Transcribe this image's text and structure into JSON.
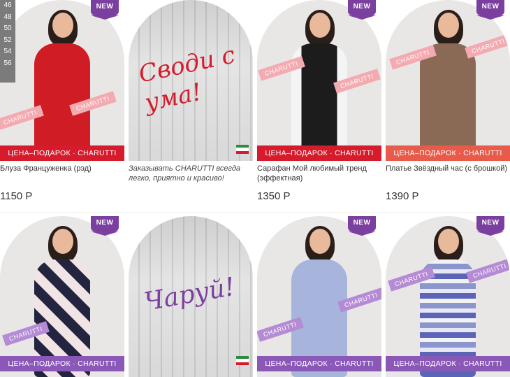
{
  "badge": "NEW",
  "strip_label": "ЦЕНА–ПОДАРОК · CHARUTTI",
  "brand_tag": "CHARUTTI",
  "sizes": [
    "46",
    "48",
    "50",
    "52",
    "54",
    "56"
  ],
  "row1": [
    {
      "name": "Блуза Француженка (рэд)",
      "price": "1150 Р"
    },
    {
      "script": "Своди с ума!",
      "caption": "Заказывать CHARUTTI всегда легко, приятно и красиво!"
    },
    {
      "name": "Сарафан Мой любимый тренд (эффектная)",
      "price": "1350 Р"
    },
    {
      "name": "Платье Звёздный час (с брошкой)",
      "price": "1390 Р"
    }
  ],
  "row2": [
    {
      "script": "Чаруй!"
    }
  ],
  "colors": {
    "badge": "#7b3fa0",
    "strip_red": "#d51b2c",
    "strip_orange": "#e85a4a",
    "strip_purple": "#8a59b8"
  }
}
